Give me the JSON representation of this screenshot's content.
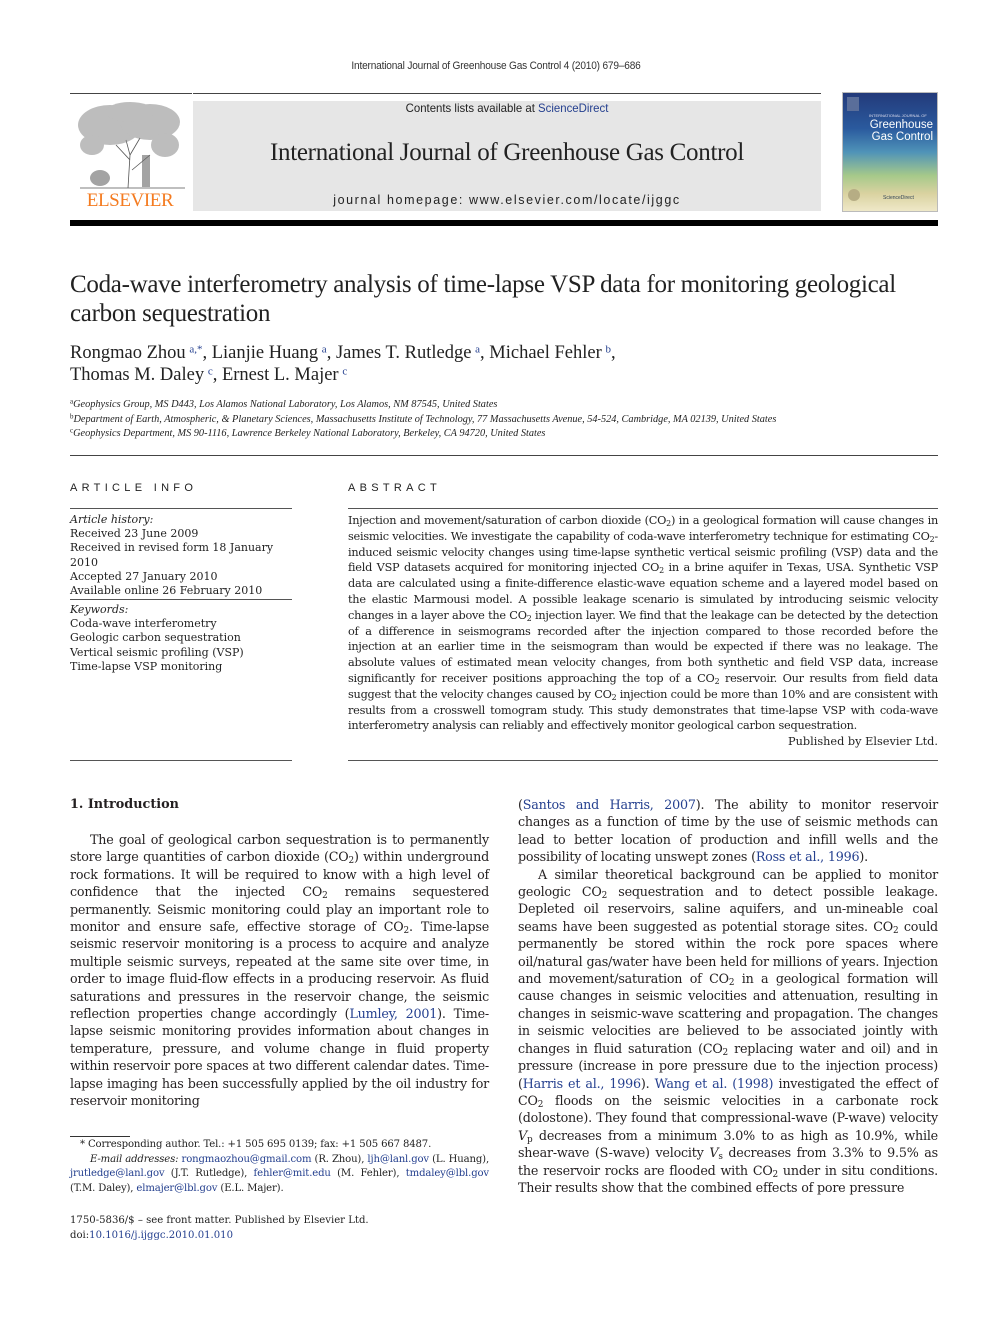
{
  "running_head": "International Journal of Greenhouse Gas Control 4 (2010) 679–686",
  "masthead": {
    "publisher_logo_text": "ELSEVIER",
    "contents_prefix": "Contents lists available at ",
    "contents_link": "ScienceDirect",
    "journal_title": "International Journal of Greenhouse Gas Control",
    "homepage": "journal homepage: www.elsevier.com/locate/ijggc",
    "cover": {
      "small_text": "INTERNATIONAL JOURNAL OF",
      "title_line1": "Greenhouse",
      "title_line2": "Gas Control",
      "footer": "ScienceDirect"
    }
  },
  "colors": {
    "link": "#25408f",
    "elsevier_orange": "#f47b20",
    "masthead_bg": "#e6e6e6"
  },
  "article": {
    "title": "Coda-wave interferometry analysis of time-lapse VSP data for monitoring geological carbon sequestration",
    "authors": [
      {
        "name": "Rongmao Zhou",
        "aff": "a,*",
        "sep": ", "
      },
      {
        "name": "Lianjie Huang",
        "aff": "a",
        "sep": ", "
      },
      {
        "name": "James T. Rutledge",
        "aff": "a",
        "sep": ", "
      },
      {
        "name": "Michael Fehler",
        "aff": "b",
        "sep": ","
      },
      {
        "name": "Thomas M. Daley",
        "aff": "c",
        "sep": ", "
      },
      {
        "name": "Ernest L. Majer",
        "aff": "c",
        "sep": ""
      }
    ],
    "affiliations": [
      {
        "key": "a",
        "text": "Geophysics Group, MS D443, Los Alamos National Laboratory, Los Alamos, NM 87545, United States"
      },
      {
        "key": "b",
        "text": "Department of Earth, Atmospheric, & Planetary Sciences, Massachusetts Institute of Technology, 77 Massachusetts Avenue, 54-524, Cambridge, MA 02139, United States"
      },
      {
        "key": "c",
        "text": "Geophysics Department, MS 90-1116, Lawrence Berkeley National Laboratory, Berkeley, CA 94720, United States"
      }
    ]
  },
  "article_info": {
    "heading": "ARTICLE INFO",
    "history_label": "Article history:",
    "history": [
      "Received 23 June 2009",
      "Received in revised form 18 January 2010",
      "Accepted 27 January 2010",
      "Available online 26 February 2010"
    ],
    "keywords_label": "Keywords:",
    "keywords": [
      "Coda-wave interferometry",
      "Geologic carbon sequestration",
      "Vertical seismic profiling (VSP)",
      "Time-lapse VSP monitoring"
    ]
  },
  "abstract": {
    "heading": "ABSTRACT",
    "segments": [
      "Injection and movement/saturation of carbon dioxide (CO",
      "2",
      ") in a geological formation will cause changes in seismic velocities. We investigate the capability of coda-wave interferometry technique for estimating CO",
      "2",
      "-induced seismic velocity changes using time-lapse synthetic vertical seismic profiling (VSP) data and the field VSP datasets acquired for monitoring injected CO",
      "2",
      " in a brine aquifer in Texas, USA. Synthetic VSP data are calculated using a finite-difference elastic-wave equation scheme and a layered model based on the elastic Marmousi model. A possible leakage scenario is simulated by introducing seismic velocity changes in a layer above the CO",
      "2",
      " injection layer. We find that the leakage can be detected by the detection of a difference in seismograms recorded after the injection compared to those recorded before the injection at an earlier time in the seismogram than would be expected if there was no leakage. The absolute values of estimated mean velocity changes, from both synthetic and field VSP data, increase significantly for receiver positions approaching the top of a CO",
      "2",
      " reservoir. Our results from field data suggest that the velocity changes caused by CO",
      "2",
      " injection could be more than 10% and are consistent with results from a crosswell tomogram study. This study demonstrates that time-lapse VSP with coda-wave interferometry analysis can reliably and effectively monitor geological carbon sequestration."
    ],
    "published_by": "Published by Elsevier Ltd."
  },
  "intro": {
    "heading": "1.  Introduction",
    "left": {
      "p1_a": "The goal of geological carbon sequestration is to permanently store large quantities of carbon dioxide (CO",
      "p1_b": ") within underground rock formations. It will be required to know with a high level of confidence that the injected CO",
      "p1_c": " remains sequestered permanently. Seismic monitoring could play an important role to monitor and ensure safe, effective storage of CO",
      "p1_d": ". Time-lapse seismic reservoir monitoring is a process to acquire and analyze multiple seismic surveys, repeated at the same site over time, in order to image fluid-flow effects in a producing reservoir. As fluid saturations and pressures in the reservoir change, the seismic reflection properties change accordingly (",
      "cite_lumley": "Lumley, 2001",
      "p1_e": "). Time-lapse seismic monitoring provides information about changes in temperature, pressure, and volume change in fluid property within reservoir pore spaces at two different calendar dates. Time-lapse imaging has been successfully applied by the oil industry for reservoir monitoring"
    },
    "right": {
      "p1_open": "(",
      "cite_santos": "Santos and Harris, 2007",
      "p1_a": "). The ability to monitor reservoir changes as a function of time by the use of seismic methods can lead to better location of production and infill wells and the possibility of locating unswept zones (",
      "cite_ross": "Ross et al., 1996",
      "p1_b": ").",
      "p2_a": "A similar theoretical background can be applied to monitor geologic CO",
      "p2_b": " sequestration and to detect possible leakage. Depleted oil reservoirs, saline aquifers, and un-mineable coal seams have been suggested as potential storage sites. CO",
      "p2_c": " could permanently be stored within the rock pore spaces where oil/natural gas/water have been held for millions of years. Injection and movement/saturation of CO",
      "p2_d": " in a geological formation will cause changes in seismic velocities and attenuation, resulting in changes in seismic-wave scattering and propagation. The changes in seismic velocities are believed to be associated jointly with changes in fluid saturation (CO",
      "p2_e": " replacing water and oil) and in pressure (increase in pore pressure due to the injection process) (",
      "cite_harris": "Harris et al., 1996",
      "p2_f": "). ",
      "cite_wang": "Wang et al. (1998)",
      "p2_g": " investigated the effect of CO",
      "p2_h": " floods on the seismic velocities in a carbonate rock (dolostone). They found that compressional-wave (P-wave) velocity ",
      "vp": "V",
      "vp_sub": "p",
      "p2_i": " decreases from a minimum 3.0% to as high as 10.9%, while shear-wave (S-wave) velocity ",
      "vs": "V",
      "vs_sub": "s",
      "p2_j": " decreases from 3.3% to 9.5% as the reservoir rocks are flooded with CO",
      "p2_k": " under in situ conditions. Their results show that the combined effects of pore pressure"
    },
    "sub2": "2"
  },
  "footnotes": {
    "corresponding": "* Corresponding author. Tel.: +1 505 695 0139; fax: +1 505 667 8487.",
    "email_label": "E-mail addresses:",
    "emails": [
      {
        "addr": "rongmaozhou@gmail.com",
        "who": " (R. Zhou), "
      },
      {
        "addr": "ljh@lanl.gov",
        "who": " (L. Huang), "
      },
      {
        "addr": "jrutledge@lanl.gov",
        "who": " (J.T. Rutledge), "
      },
      {
        "addr": "fehler@mit.edu",
        "who": " (M. Fehler), "
      },
      {
        "addr": "tmdaley@lbl.gov",
        "who": " (T.M. Daley), "
      },
      {
        "addr": "elmajer@lbl.gov",
        "who": " (E.L. Majer)."
      }
    ],
    "issn": "1750-5836/$ – see front matter. Published by Elsevier Ltd.",
    "doi_prefix": "doi:",
    "doi": "10.1016/j.ijggc.2010.01.010"
  }
}
